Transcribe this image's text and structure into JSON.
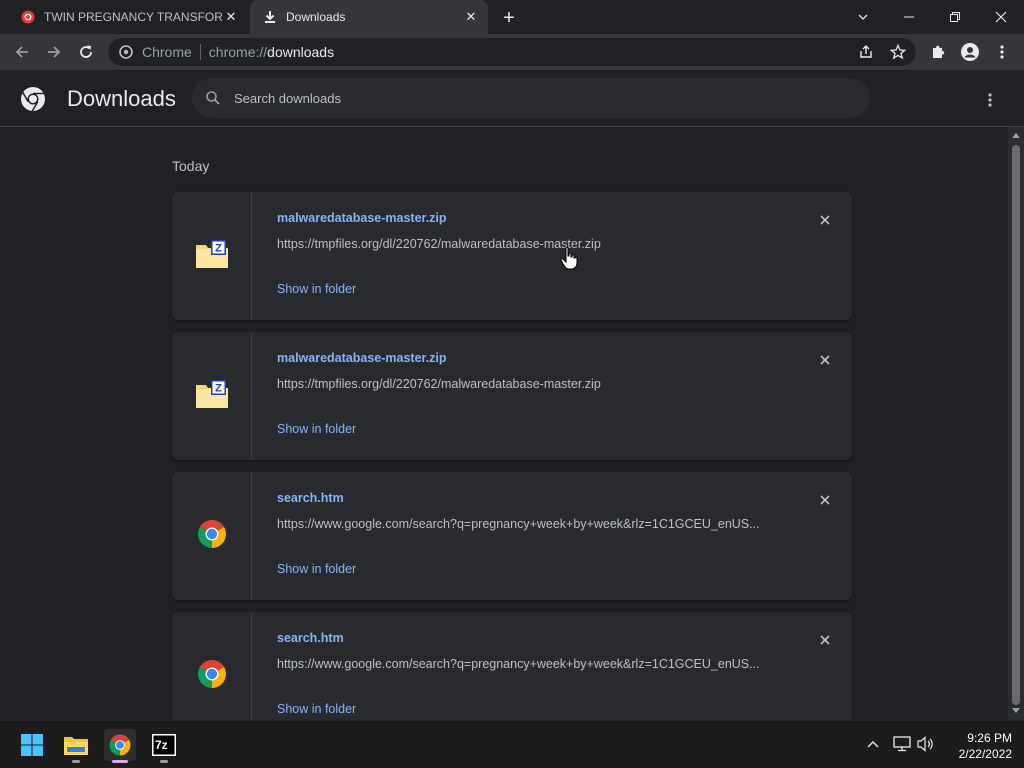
{
  "tabs": [
    {
      "title": "TWIN PREGNANCY TRANSFORM",
      "active": false
    },
    {
      "title": "Downloads",
      "active": true
    }
  ],
  "omnibox": {
    "site": "Chrome",
    "scheme": "chrome://",
    "host": "downloads"
  },
  "page": {
    "title": "Downloads",
    "search_placeholder": "Search downloads",
    "date_header": "Today"
  },
  "downloads": [
    {
      "filename": "malwaredatabase-master.zip",
      "url": "https://tmpfiles.org/dl/220762/malwaredatabase-master.zip",
      "action": "Show in folder",
      "icon": "zip-folder-icon"
    },
    {
      "filename": "malwaredatabase-master.zip",
      "url": "https://tmpfiles.org/dl/220762/malwaredatabase-master.zip",
      "action": "Show in folder",
      "icon": "zip-folder-icon"
    },
    {
      "filename": "search.htm",
      "url": "https://www.google.com/search?q=pregnancy+week+by+week&rlz=1C1GCEU_enUS...",
      "action": "Show in folder",
      "icon": "chrome-icon"
    },
    {
      "filename": "search.htm",
      "url": "https://www.google.com/search?q=pregnancy+week+by+week&rlz=1C1GCEU_enUS...",
      "action": "Show in folder",
      "icon": "chrome-icon"
    }
  ],
  "taskbar": {
    "time": "9:26 PM",
    "date": "2/22/2022",
    "sevenzip_label": "7z"
  },
  "colors": {
    "accent": "#8ab4f8",
    "background": "#202124",
    "card": "#292a2d"
  }
}
